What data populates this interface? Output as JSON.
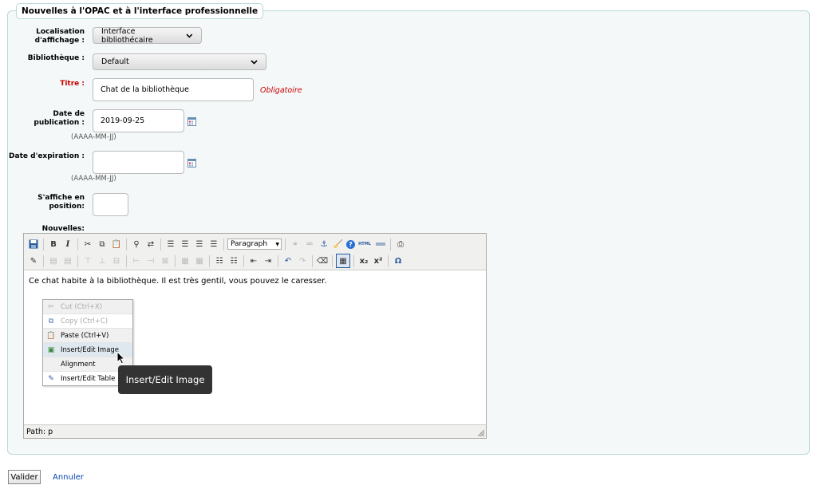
{
  "legend": "Nouvelles à l'OPAC et à l'interface professionnelle",
  "fields": {
    "location_label": "Localisation d'affichage :",
    "location_value": "Interface bibliothécaire",
    "library_label": "Bibliothèque :",
    "library_value": "Default",
    "title_label": "Titre :",
    "title_value": "Chat de la bibliothèque",
    "required": "Obligatoire",
    "pubdate_label": "Date de publication :",
    "pubdate_value": "2019-09-25",
    "date_hint": "(AAAA-MM-JJ)",
    "expdate_label": "Date d'expiration :",
    "expdate_value": "",
    "position_label": "S'affiche en position:",
    "position_value": "",
    "news_label": "Nouvelles:"
  },
  "editor": {
    "format_select": "Paragraph",
    "content": "Ce chat habite à la bibliothèque. Il est très gentil, vous pouvez le caresser.",
    "path": "Path: p",
    "html_btn": "HTML"
  },
  "context_menu": {
    "items": [
      {
        "label": "Cut (Ctrl+X)",
        "icon": "scissors-icon"
      },
      {
        "label": "Copy (Ctrl+C)",
        "icon": "copy-icon"
      },
      {
        "label": "Paste (Ctrl+V)",
        "icon": "paste-icon"
      },
      {
        "label": "Insert/Edit Image",
        "icon": "image-icon"
      },
      {
        "label": "Alignment",
        "icon": ""
      },
      {
        "label": "Insert/Edit Table",
        "icon": "table-icon"
      }
    ]
  },
  "tooltip": "Insert/Edit Image",
  "actions": {
    "submit": "Valider",
    "cancel": "Annuler"
  }
}
